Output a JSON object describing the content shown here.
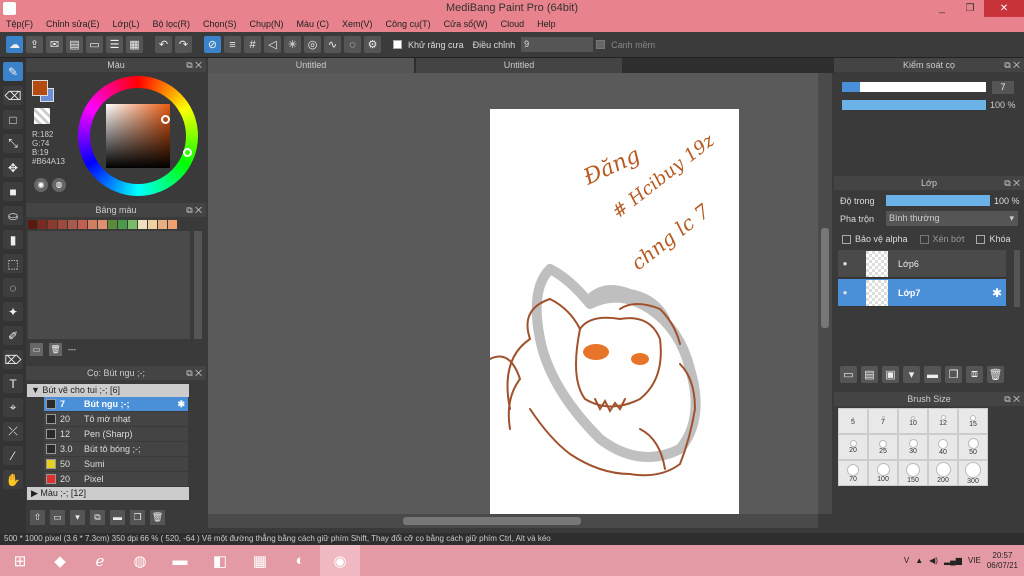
{
  "window": {
    "title": "MediBang Paint Pro (64bit)",
    "min": "_",
    "max": "❐",
    "close": "✕"
  },
  "menu": [
    "Tệp(F)",
    "Chỉnh sửa(E)",
    "Lớp(L)",
    "Bộ lọc(R)",
    "Chọn(S)",
    "Chụp(N)",
    "Màu (C)",
    "Xem(V)",
    "Công cụ(T)",
    "Cửa sổ(W)",
    "Cloud",
    "Help"
  ],
  "toolbar": {
    "antialias_label": "Khử răng cưa",
    "adjust_label": "Điều chỉnh",
    "adjust_value": "9",
    "snap_label": "Canh mềm"
  },
  "color_panel": {
    "title": "Màu",
    "main_color": "#B64A13",
    "r": "R:182",
    "g": "G:74",
    "b": "B:19",
    "hex": "#B64A13"
  },
  "palette_panel": {
    "title": "Bảng màu",
    "footer_text": "---",
    "colors": [
      "#5a1a10",
      "#7a2a1e",
      "#8b3a2e",
      "#9a4a3e",
      "#aa5a4a",
      "#c06050",
      "#d08060",
      "#e09070",
      "#5a8a3a",
      "#4a9a4a",
      "#7aba6a",
      "#f0e0c0",
      "#f0d0a0",
      "#e8b080",
      "#f0a070"
    ]
  },
  "brush_panel": {
    "title": "Cọ: Bút ngu ;-;",
    "group1": "▼  Bút vẽ cho tui ;-; [6]",
    "group2": "▶  Màu ;-; [12]",
    "brushes": [
      {
        "size": "7",
        "name": "Bút ngu ;-;",
        "color": "#2a2a2a",
        "gear": "✱"
      },
      {
        "size": "20",
        "name": "Tô mờ nhạt",
        "color": "#2a2a2a"
      },
      {
        "size": "12",
        "name": "Pen (Sharp)",
        "color": "#2a2a2a"
      },
      {
        "size": "3.0",
        "name": "Bút tô bóng ;-;",
        "color": "#2a2a2a"
      },
      {
        "size": "50",
        "name": "Sumi",
        "color": "#e8d020"
      },
      {
        "size": "20",
        "name": "Pixel",
        "color": "#e03030"
      }
    ]
  },
  "tabs": [
    "Untitled",
    "Untitled"
  ],
  "status": "500 * 1000 pixel   (3.6 * 7.3cm)   350 dpi   66 %   ( 520, -64 )   Vẽ một đường thẳng bằng cách giữ phím Shift, Thay đổi cỡ cọ bằng cách giữ phím Ctrl, Alt và kéo",
  "control_panel": {
    "title": "Kiểm soát cọ",
    "size_value": "7",
    "opacity_value": "100 %"
  },
  "layer_panel": {
    "title": "Lớp",
    "opacity_label": "Độ trong",
    "opacity_value": "100 %",
    "blend_label": "Pha trộn",
    "blend_value": "Bình thường",
    "protect_alpha": "Bảo vệ alpha",
    "clipping": "Xén bớt",
    "lock": "Khóa",
    "layers": [
      {
        "name": "Lớp6",
        "selected": false
      },
      {
        "name": "Lớp7",
        "selected": true,
        "gear": "✱"
      }
    ]
  },
  "brush_size": {
    "title": "Brush Size",
    "sizes": [
      "5",
      "7",
      "10",
      "12",
      "15",
      "20",
      "25",
      "30",
      "40",
      "50",
      "70",
      "100",
      "150",
      "200",
      "300"
    ]
  },
  "canvas_text": [
    "Đăng",
    "# Hcibuy 19z",
    "chng lc 7"
  ],
  "taskbar": {
    "time": "20:57",
    "date": "06/07/21",
    "lang": "VIE"
  }
}
